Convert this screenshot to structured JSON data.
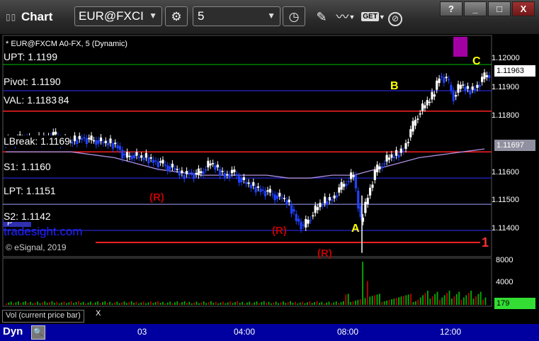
{
  "window": {
    "title": "Chart",
    "symbol": "EUR@FXCI",
    "interval": "5",
    "buttons": {
      "help": "?",
      "minimize": "_",
      "maximize": "□",
      "close": "X"
    }
  },
  "chart": {
    "subtitle": "* EUR@FXCM A0-FX, 5 (Dynamic)",
    "levels": [
      {
        "label": "UPT: 1.1199",
        "price": 1.1199,
        "color": "#00c000"
      },
      {
        "label": "Pivot: 1.1190",
        "price": 1.119,
        "color": "#3030ff"
      },
      {
        "label": "VAL: 1.1183",
        "price": 1.1183,
        "color": "#ff2020"
      },
      {
        "label": "LBreak: 1.1169",
        "price": 1.1169,
        "color": "#ff2020"
      },
      {
        "label": "S1: 1.1160",
        "price": 1.116,
        "color": "#3030ff"
      },
      {
        "label": "LPT: 1.1151",
        "price": 1.1151,
        "color": "#a0a0ff"
      },
      {
        "label": "S2: 1.1142",
        "price": 1.1142,
        "color": "#3030ff"
      }
    ],
    "val_suffix": "84",
    "watermark": "tradesight.com",
    "copyright": "© eSignal, 2019",
    "fib_marker": "P",
    "annotations": [
      {
        "text": "A",
        "color": "#ffff00"
      },
      {
        "text": "B",
        "color": "#ffff00"
      },
      {
        "text": "C",
        "color": "#ffff00"
      },
      {
        "text": "(R)",
        "color": "#c00000"
      },
      {
        "text": "(R)",
        "color": "#c00000"
      },
      {
        "text": "(R)",
        "color": "#c00000"
      },
      {
        "text": "1",
        "color": "#ff3030"
      }
    ],
    "price_scale": [
      "1.12000",
      "1.11900",
      "1.11800",
      "1.11700",
      "1.11600",
      "1.11500",
      "1.11400"
    ],
    "last_price": "1.11963",
    "ma_value": "1.11697",
    "volume_scale": [
      "8000",
      "4000"
    ],
    "volume_value": "179",
    "volume_label": "Vol (current price bar)",
    "volume_close": "X",
    "time_labels": [
      "03",
      "04:00",
      "08:00",
      "12:00"
    ],
    "mode": "Dyn"
  },
  "chart_data": {
    "type": "candlestick",
    "title": "* EUR@FXCM A0-FX, 5 (Dynamic)",
    "ylim": [
      1.1133,
      1.1209
    ],
    "y_ticks": [
      1.12,
      1.119,
      1.118,
      1.117,
      1.116,
      1.115,
      1.114
    ],
    "x_ticks": [
      "03",
      "04:00",
      "08:00",
      "12:00"
    ],
    "close_path": [
      1.1173,
      1.1173,
      1.1174,
      1.1172,
      1.1173,
      1.1174,
      1.1175,
      1.1173,
      1.1172,
      1.1173,
      1.1174,
      1.1173,
      1.1173,
      1.1172,
      1.1172,
      1.1171,
      1.1167,
      1.1168,
      1.1167,
      1.1167,
      1.1166,
      1.1165,
      1.1164,
      1.1163,
      1.1161,
      1.1162,
      1.1161,
      1.1163,
      1.1165,
      1.1163,
      1.1161,
      1.1162,
      1.116,
      1.1158,
      1.1157,
      1.1156,
      1.1155,
      1.1154,
      1.1153,
      1.1151,
      1.1146,
      1.1143,
      1.1147,
      1.115,
      1.1152,
      1.1153,
      1.1156,
      1.1159,
      1.1161,
      1.1145,
      1.1154,
      1.1162,
      1.1165,
      1.1167,
      1.1168,
      1.117,
      1.1176,
      1.1182,
      1.1185,
      1.1188,
      1.1195,
      1.1194,
      1.1188,
      1.1192,
      1.119,
      1.1191,
      1.1194,
      1.1196
    ],
    "ma_path": [
      1.1169,
      1.1169,
      1.1169,
      1.1169,
      1.1168,
      1.1167,
      1.1165,
      1.1163,
      1.1162,
      1.1161,
      1.1161,
      1.1161,
      1.1161,
      1.116,
      1.116,
      1.1161,
      1.1161,
      1.1163,
      1.1165,
      1.1167,
      1.1168,
      1.1169,
      1.117
    ],
    "volume_max": 8000,
    "volume_last": 179
  }
}
